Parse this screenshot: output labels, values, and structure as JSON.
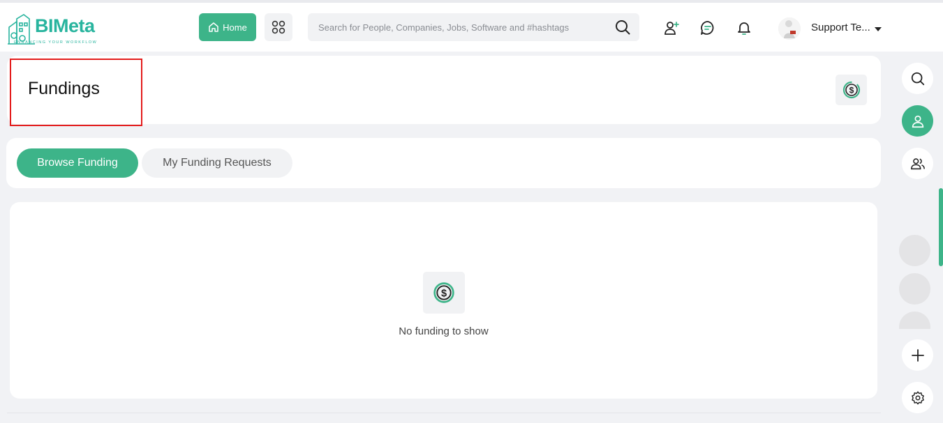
{
  "header": {
    "logo_text": "BIMeta",
    "logo_tagline": "ENHANCING YOUR WORKFLOW",
    "home_label": "Home",
    "search_placeholder": "Search for People, Companies, Jobs, Software and #hashtags",
    "user_name": "Support Te...",
    "icons": [
      "home-icon",
      "apps-icon",
      "search-icon",
      "add-user-icon",
      "chat-icon",
      "bell-icon",
      "caret-down-icon"
    ]
  },
  "page": {
    "title": "Fundings",
    "title_icon": "dollar-circle-icon"
  },
  "tabs": [
    {
      "label": "Browse Funding",
      "active": true
    },
    {
      "label": "My Funding Requests",
      "active": false
    }
  ],
  "content": {
    "empty_icon": "dollar-circle-icon",
    "empty_text": "No funding to show"
  },
  "right_rail": {
    "icons": [
      "search-icon",
      "user-icon",
      "users-icon",
      "plus-icon",
      "gear-icon"
    ]
  },
  "colors": {
    "accent": "#3db489",
    "logo": "#28b49e",
    "highlight": "#e31b1b",
    "background": "#f1f2f5"
  }
}
